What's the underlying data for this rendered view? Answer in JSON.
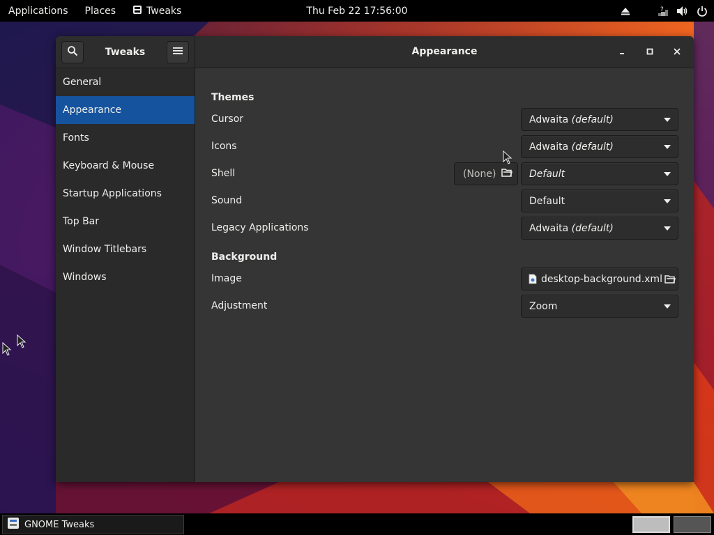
{
  "topbar": {
    "applications": "Applications",
    "places": "Places",
    "app_name": "Tweaks",
    "clock": "Thu Feb 22  17:56:00"
  },
  "window": {
    "sidebar_title": "Tweaks",
    "title": "Appearance"
  },
  "sidebar": {
    "items": [
      {
        "label": "General"
      },
      {
        "label": "Appearance"
      },
      {
        "label": "Fonts"
      },
      {
        "label": "Keyboard & Mouse"
      },
      {
        "label": "Startup Applications"
      },
      {
        "label": "Top Bar"
      },
      {
        "label": "Window Titlebars"
      },
      {
        "label": "Windows"
      }
    ],
    "active_index": 1
  },
  "themes": {
    "heading": "Themes",
    "cursor": {
      "label": "Cursor",
      "value": "Adwaita",
      "suffix": "(default)"
    },
    "icons": {
      "label": "Icons",
      "value": "Adwaita",
      "suffix": "(default)"
    },
    "shell": {
      "label": "Shell",
      "none_label": "(None)",
      "value": "Default"
    },
    "sound": {
      "label": "Sound",
      "value": "Default"
    },
    "legacy": {
      "label": "Legacy Applications",
      "value": "Adwaita",
      "suffix": "(default)"
    }
  },
  "background": {
    "heading": "Background",
    "image": {
      "label": "Image",
      "value": "desktop-background.xml"
    },
    "adjustment": {
      "label": "Adjustment",
      "value": "Zoom"
    }
  },
  "taskbar": {
    "task_label": "GNOME Tweaks"
  },
  "colors": {
    "accent": "#15539e",
    "window_bg": "#353535",
    "sidebar_bg": "#2a2a2a"
  }
}
